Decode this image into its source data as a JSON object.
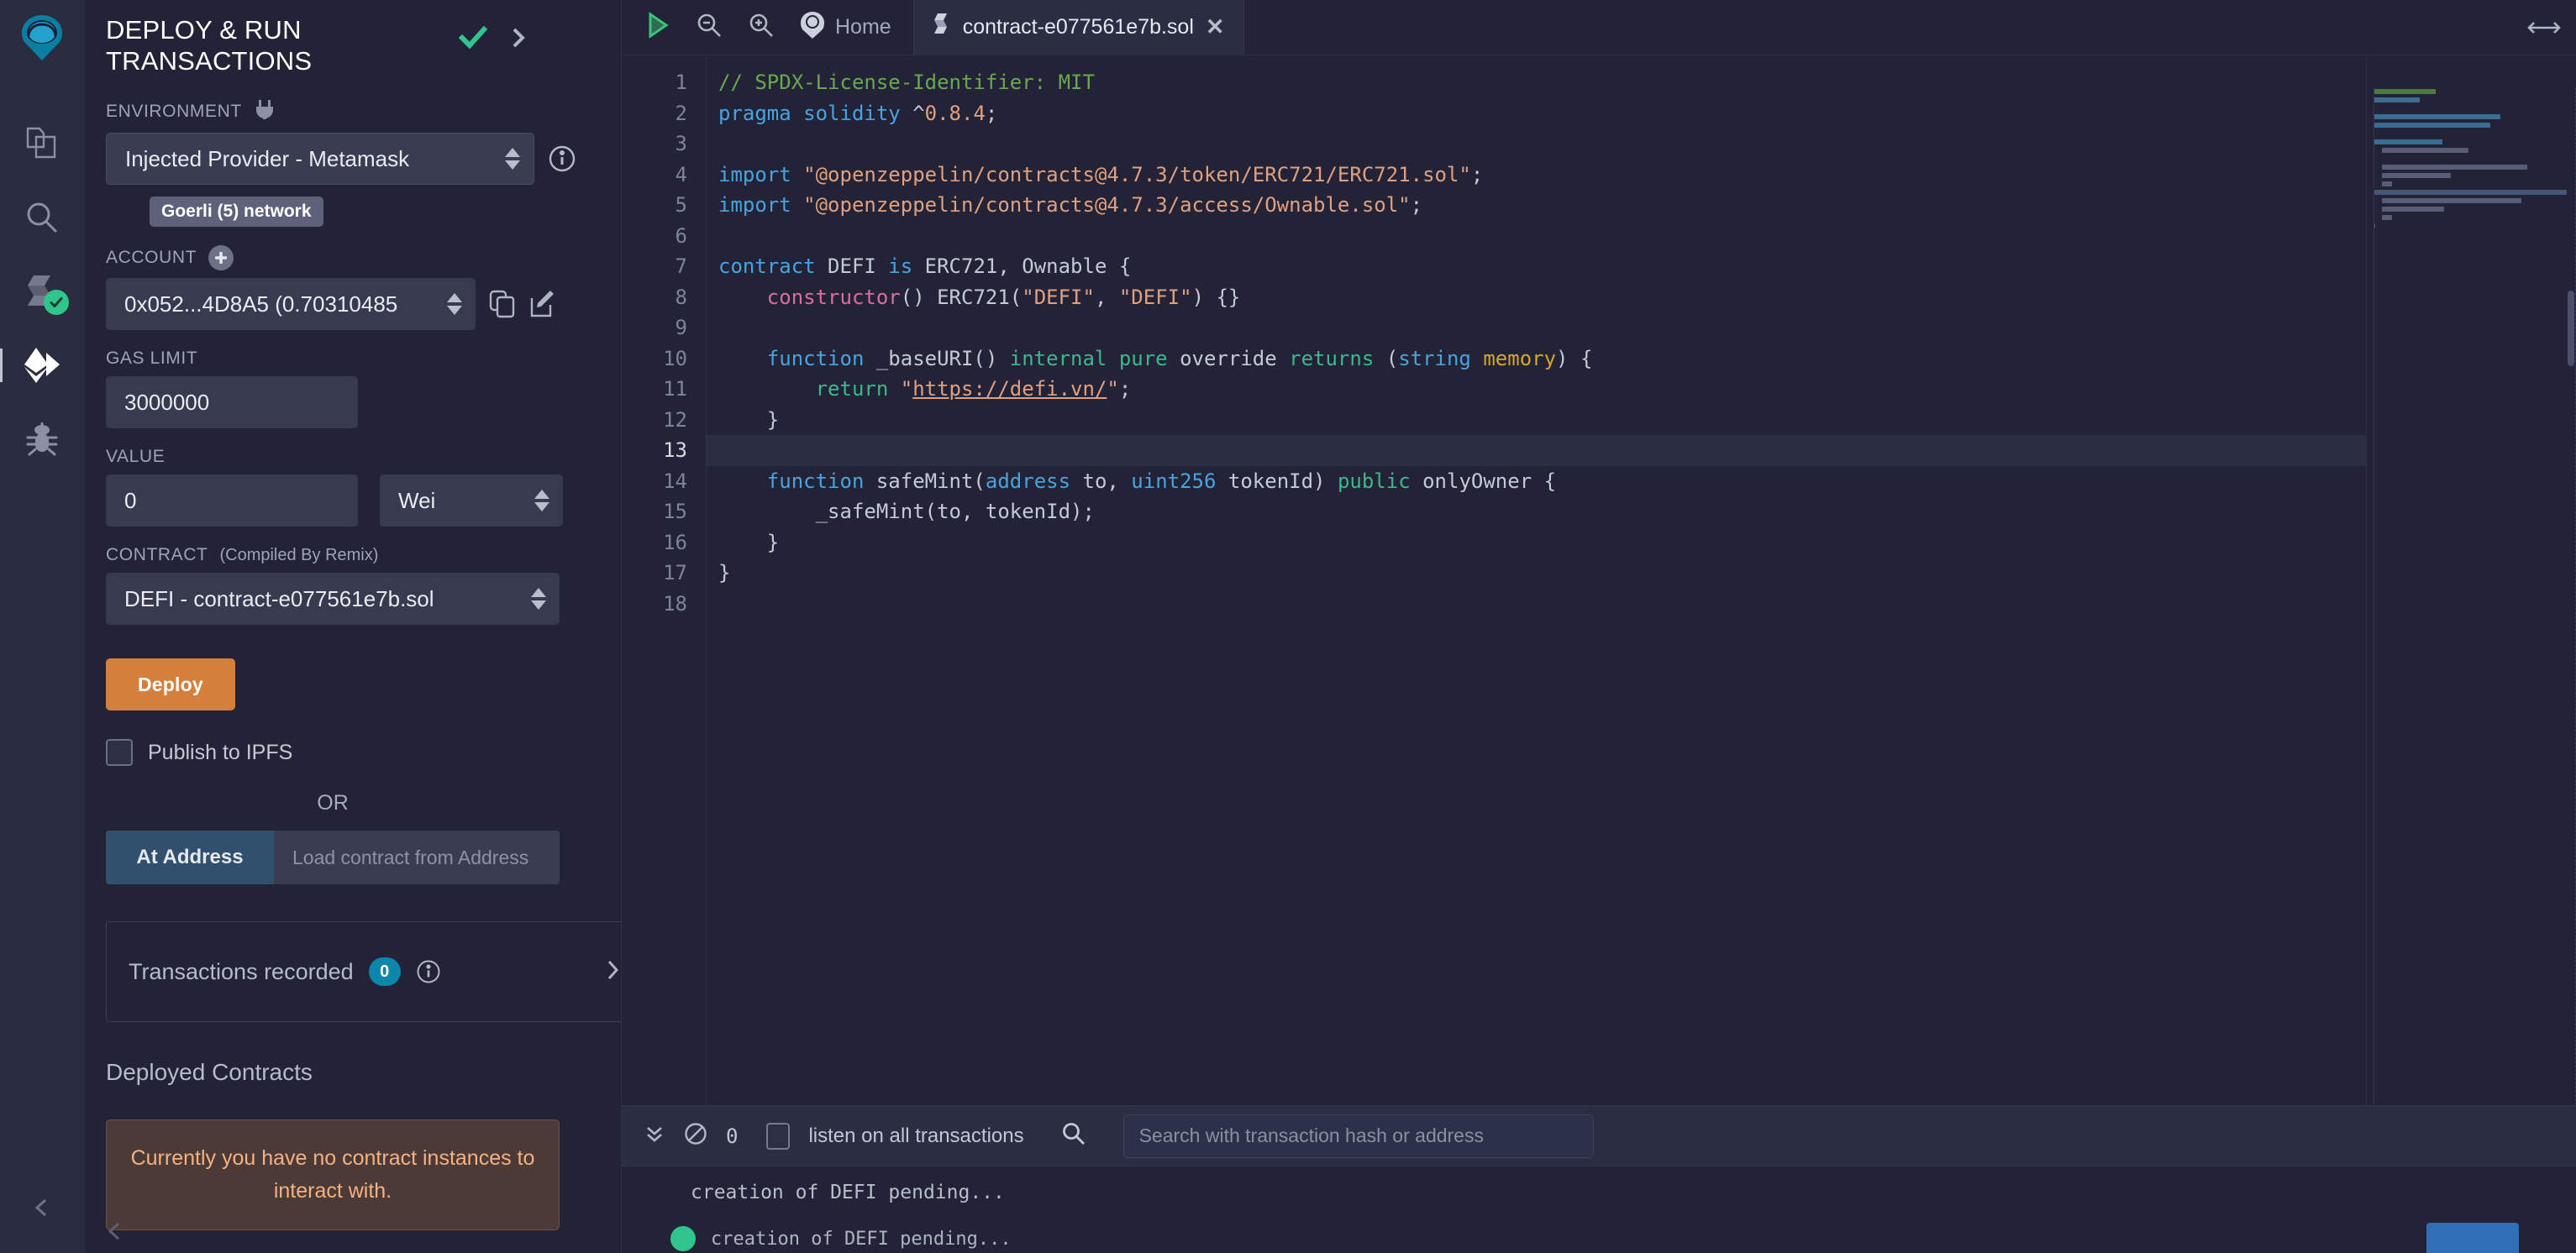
{
  "app": {
    "name": "Remix IDE",
    "accent_orange": "#d4803c",
    "accent_blue": "#0d86ab",
    "accent_green": "#32c48d",
    "bg": "#222336",
    "panel_bg": "#2a2c3f"
  },
  "icon_rail": {
    "items": [
      {
        "name": "remix-logo",
        "label": "Remix"
      },
      {
        "name": "file-explorer-icon",
        "label": "File explorer"
      },
      {
        "name": "search-icon",
        "label": "Search in files"
      },
      {
        "name": "solidity-compiler-icon",
        "label": "Solidity compiler",
        "status": "success"
      },
      {
        "name": "deploy-run-icon",
        "label": "Deploy & run transactions",
        "active": true
      },
      {
        "name": "debugger-icon",
        "label": "Debugger"
      },
      {
        "name": "settings-arrow-icon",
        "label": "Settings"
      }
    ]
  },
  "panel": {
    "title": "DEPLOY & RUN TRANSACTIONS",
    "head_icons": [
      {
        "name": "checkmark-icon",
        "label": "All ok"
      },
      {
        "name": "chevron-right-icon",
        "label": "Expand"
      }
    ],
    "environment": {
      "label": "ENVIRONMENT",
      "plug_icon": "plug-icon",
      "value": "Injected Provider - Metamask",
      "network_chip": "Goerli (5) network",
      "info_icon": "info-icon"
    },
    "account": {
      "label": "ACCOUNT",
      "add_icon": "plus-circle-icon",
      "value": "0x052...4D8A5 (0.70310485",
      "copy_icon": "copy-icon",
      "edit_icon": "edit-icon"
    },
    "gas_limit": {
      "label": "GAS LIMIT",
      "value": "3000000"
    },
    "value_field": {
      "label": "VALUE",
      "value": "0",
      "unit": "Wei"
    },
    "contract": {
      "label": "CONTRACT",
      "sublabel": "(Compiled By Remix)",
      "value": "DEFI - contract-e077561e7b.sol"
    },
    "deploy_button": "Deploy",
    "publish_ipfs": {
      "label": "Publish to IPFS",
      "checked": false
    },
    "or_text": "OR",
    "at_address": {
      "button": "At Address",
      "placeholder": "Load contract from Address"
    },
    "transactions_recorded": {
      "label": "Transactions recorded",
      "count": "0",
      "info_icon": "info-icon",
      "chevron_icon": "chevron-right-icon"
    },
    "deployed_contracts": {
      "title": "Deployed Contracts",
      "empty_message": "Currently you have no contract instances to interact with."
    }
  },
  "toolbar": {
    "run_icon": "play-icon",
    "zoom_out_icon": "zoom-out-icon",
    "zoom_in_icon": "zoom-in-icon",
    "home_icon": "remix-home-icon",
    "home_label": "Home",
    "resize_icon": "horizontal-resize-icon"
  },
  "tabs": [
    {
      "label": "contract-e077561e7b.sol",
      "icon": "solidity-file-icon",
      "close_icon": "close-icon",
      "active": true
    }
  ],
  "editor": {
    "active_line": 13,
    "lines": [
      {
        "n": 1,
        "tokens": [
          {
            "t": "// SPDX-License-Identifier: MIT",
            "c": "comment"
          }
        ]
      },
      {
        "n": 2,
        "tokens": [
          {
            "t": "pragma",
            "c": "key"
          },
          {
            "t": " ",
            "c": "plain"
          },
          {
            "t": "solidity",
            "c": "key"
          },
          {
            "t": " ^",
            "c": "plain"
          },
          {
            "t": "0.8.4",
            "c": "num"
          },
          {
            "t": ";",
            "c": "plain"
          }
        ]
      },
      {
        "n": 3,
        "tokens": []
      },
      {
        "n": 4,
        "tokens": [
          {
            "t": "import",
            "c": "key"
          },
          {
            "t": " ",
            "c": "plain"
          },
          {
            "t": "\"@openzeppelin/contracts@4.7.3/token/ERC721/ERC721.sol\"",
            "c": "str"
          },
          {
            "t": ";",
            "c": "plain"
          }
        ]
      },
      {
        "n": 5,
        "tokens": [
          {
            "t": "import",
            "c": "key"
          },
          {
            "t": " ",
            "c": "plain"
          },
          {
            "t": "\"@openzeppelin/contracts@4.7.3/access/Ownable.sol\"",
            "c": "str"
          },
          {
            "t": ";",
            "c": "plain"
          }
        ]
      },
      {
        "n": 6,
        "tokens": []
      },
      {
        "n": 7,
        "tokens": [
          {
            "t": "contract",
            "c": "key"
          },
          {
            "t": " DEFI ",
            "c": "plain"
          },
          {
            "t": "is",
            "c": "key"
          },
          {
            "t": " ERC721, Ownable {",
            "c": "plain"
          }
        ]
      },
      {
        "n": 8,
        "tokens": [
          {
            "t": "    ",
            "c": "plain"
          },
          {
            "t": "constructor",
            "c": "ctor"
          },
          {
            "t": "() ERC721(",
            "c": "plain"
          },
          {
            "t": "\"DEFI\"",
            "c": "str"
          },
          {
            "t": ", ",
            "c": "plain"
          },
          {
            "t": "\"DEFI\"",
            "c": "str"
          },
          {
            "t": ") {}",
            "c": "plain"
          }
        ]
      },
      {
        "n": 9,
        "tokens": []
      },
      {
        "n": 10,
        "tokens": [
          {
            "t": "    ",
            "c": "plain"
          },
          {
            "t": "function",
            "c": "key"
          },
          {
            "t": " _baseURI() ",
            "c": "plain"
          },
          {
            "t": "internal",
            "c": "green"
          },
          {
            "t": " ",
            "c": "plain"
          },
          {
            "t": "pure",
            "c": "green"
          },
          {
            "t": " override ",
            "c": "plain"
          },
          {
            "t": "returns",
            "c": "green"
          },
          {
            "t": " (",
            "c": "plain"
          },
          {
            "t": "string",
            "c": "type"
          },
          {
            "t": " ",
            "c": "plain"
          },
          {
            "t": "memory",
            "c": "mem"
          },
          {
            "t": ") {",
            "c": "plain"
          }
        ]
      },
      {
        "n": 11,
        "tokens": [
          {
            "t": "        ",
            "c": "plain"
          },
          {
            "t": "return",
            "c": "green"
          },
          {
            "t": " ",
            "c": "plain"
          },
          {
            "t": "\"",
            "c": "str"
          },
          {
            "t": "https://defi.vn/",
            "c": "link"
          },
          {
            "t": "\"",
            "c": "str"
          },
          {
            "t": ";",
            "c": "plain"
          }
        ]
      },
      {
        "n": 12,
        "tokens": [
          {
            "t": "    }",
            "c": "plain"
          }
        ]
      },
      {
        "n": 13,
        "tokens": []
      },
      {
        "n": 14,
        "tokens": [
          {
            "t": "    ",
            "c": "plain"
          },
          {
            "t": "function",
            "c": "key"
          },
          {
            "t": " safeMint(",
            "c": "plain"
          },
          {
            "t": "address",
            "c": "type"
          },
          {
            "t": " to, ",
            "c": "plain"
          },
          {
            "t": "uint256",
            "c": "type"
          },
          {
            "t": " tokenId) ",
            "c": "plain"
          },
          {
            "t": "public",
            "c": "green"
          },
          {
            "t": " onlyOwner {",
            "c": "plain"
          }
        ]
      },
      {
        "n": 15,
        "tokens": [
          {
            "t": "        _safeMint(to, tokenId);",
            "c": "plain"
          }
        ]
      },
      {
        "n": 16,
        "tokens": [
          {
            "t": "    }",
            "c": "plain"
          }
        ]
      },
      {
        "n": 17,
        "tokens": [
          {
            "t": "}",
            "c": "plain"
          }
        ]
      },
      {
        "n": 18,
        "tokens": []
      }
    ]
  },
  "terminal": {
    "collapse_icon": "double-chevron-down-icon",
    "clear_icon": "no-entry-icon",
    "count": "0",
    "listen_label": "listen on all transactions",
    "listen_checked": false,
    "search_icon": "search-icon",
    "search_placeholder": "Search with transaction hash or address",
    "logs": [
      "creation of DEFI pending..."
    ],
    "pending_tx": {
      "status_icon": "success-circle-icon",
      "text": "creation of DEFI pending..."
    }
  }
}
